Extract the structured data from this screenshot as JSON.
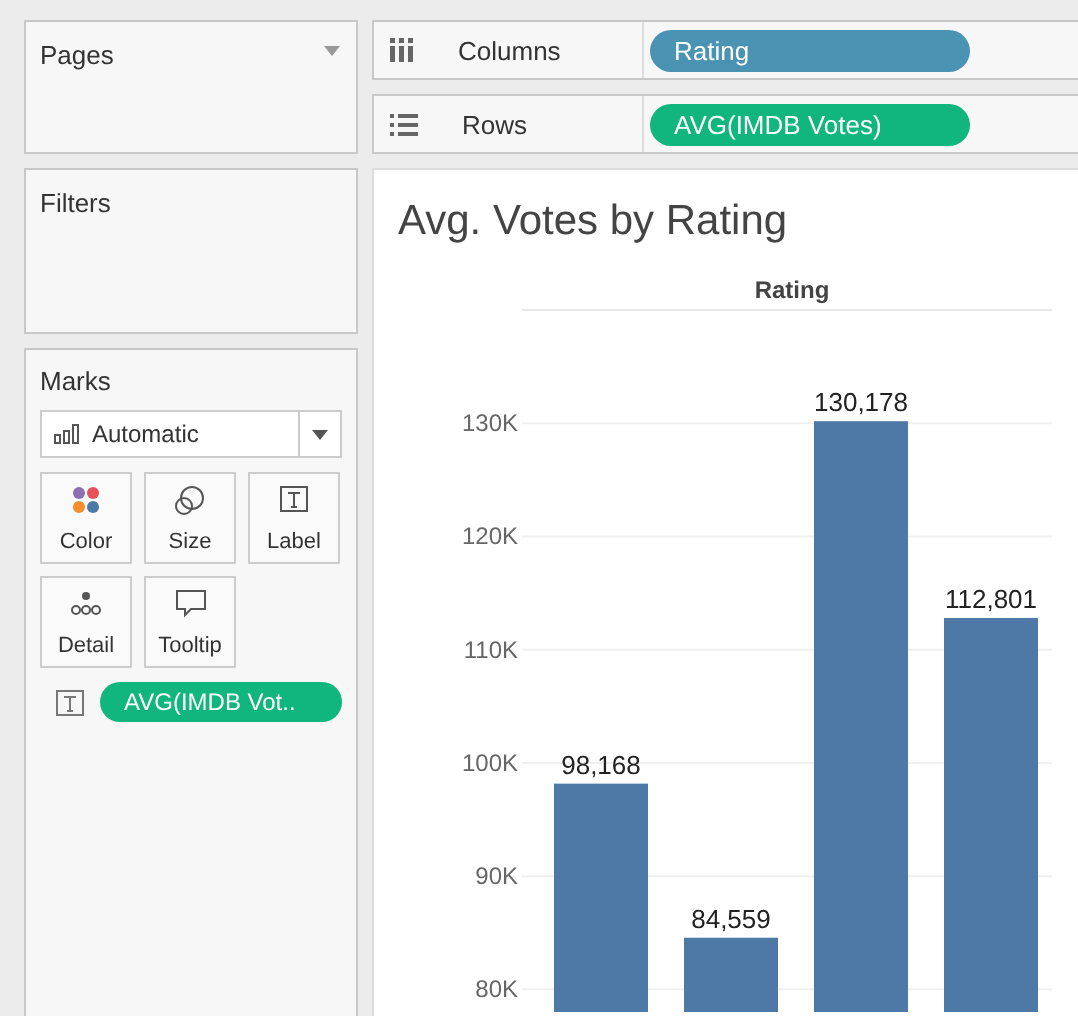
{
  "pages": {
    "title": "Pages"
  },
  "shelves": [
    {
      "kind": "columns",
      "label": "Columns",
      "pill": "Rating",
      "color": "#4a93b2"
    },
    {
      "kind": "rows",
      "label": "Rows",
      "pill": "AVG(IMDB Votes)",
      "color": "#11b57e"
    }
  ],
  "filters": {
    "title": "Filters"
  },
  "marks": {
    "title": "Marks",
    "mark_type": "Automatic",
    "buttons": [
      {
        "kind": "color",
        "label": "Color"
      },
      {
        "kind": "size",
        "label": "Size"
      },
      {
        "kind": "label",
        "label": "Label"
      },
      {
        "kind": "detail",
        "label": "Detail"
      },
      {
        "kind": "tooltip",
        "label": "Tooltip"
      }
    ],
    "field": {
      "pill": "AVG(IMDB Vot..",
      "color": "#11b57e"
    }
  },
  "chart": {
    "title": "Avg. Votes by Rating",
    "chart_data": {
      "type": "bar",
      "xlabel": "Rating",
      "grid": true,
      "series": [
        {
          "color": "#4e79a7",
          "values": [
            98168,
            84559,
            130178,
            112801
          ]
        }
      ],
      "value_labels": [
        "98,168",
        "84,559",
        "130,178",
        "112,801"
      ],
      "ylim": [
        78000,
        140000
      ],
      "yticks": [
        {
          "value": 80000,
          "label": "80K"
        },
        {
          "value": 90000,
          "label": "90K"
        },
        {
          "value": 100000,
          "label": "100K"
        },
        {
          "value": 110000,
          "label": "110K"
        },
        {
          "value": 120000,
          "label": "120K"
        },
        {
          "value": 130000,
          "label": "130K"
        }
      ]
    }
  }
}
